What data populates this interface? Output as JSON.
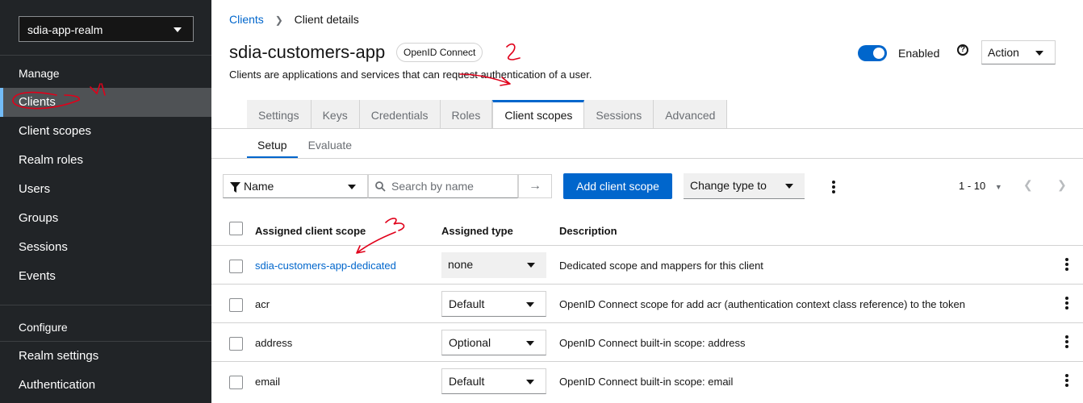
{
  "sidebar": {
    "realm": "sdia-app-realm",
    "manage_heading": "Manage",
    "configure_heading": "Configure",
    "items": [
      {
        "label": "Clients"
      },
      {
        "label": "Client scopes"
      },
      {
        "label": "Realm roles"
      },
      {
        "label": "Users"
      },
      {
        "label": "Groups"
      },
      {
        "label": "Sessions"
      },
      {
        "label": "Events"
      }
    ],
    "config_items": [
      {
        "label": "Realm settings"
      },
      {
        "label": "Authentication"
      }
    ]
  },
  "breadcrumb": {
    "parent": "Clients",
    "current": "Client details"
  },
  "header": {
    "title": "sdia-customers-app",
    "badge": "OpenID Connect",
    "subtitle": "Clients are applications and services that can request authentication of a user.",
    "enabled_label": "Enabled",
    "enabled": true,
    "action_label": "Action"
  },
  "tabs": [
    {
      "label": "Settings"
    },
    {
      "label": "Keys"
    },
    {
      "label": "Credentials"
    },
    {
      "label": "Roles"
    },
    {
      "label": "Client scopes"
    },
    {
      "label": "Sessions"
    },
    {
      "label": "Advanced"
    }
  ],
  "subtabs": [
    {
      "label": "Setup"
    },
    {
      "label": "Evaluate"
    }
  ],
  "toolbar": {
    "filter_label": "Name",
    "search_placeholder": "Search by name",
    "add_button": "Add client scope",
    "change_type": "Change type to",
    "pagination": "1 - 10"
  },
  "table": {
    "headers": {
      "scope": "Assigned client scope",
      "type": "Assigned type",
      "description": "Description"
    },
    "rows": [
      {
        "scope": "sdia-customers-app-dedicated",
        "type": "none",
        "description": "Dedicated scope and mappers for this client"
      },
      {
        "scope": "acr",
        "type": "Default",
        "description": "OpenID Connect scope for add acr (authentication context class reference) to the token"
      },
      {
        "scope": "address",
        "type": "Optional",
        "description": "OpenID Connect built-in scope: address"
      },
      {
        "scope": "email",
        "type": "Default",
        "description": "OpenID Connect built-in scope: email"
      }
    ]
  },
  "colors": {
    "accent": "#0066cc",
    "sidebar_bg": "#212427",
    "annotation": "#e0001a"
  }
}
